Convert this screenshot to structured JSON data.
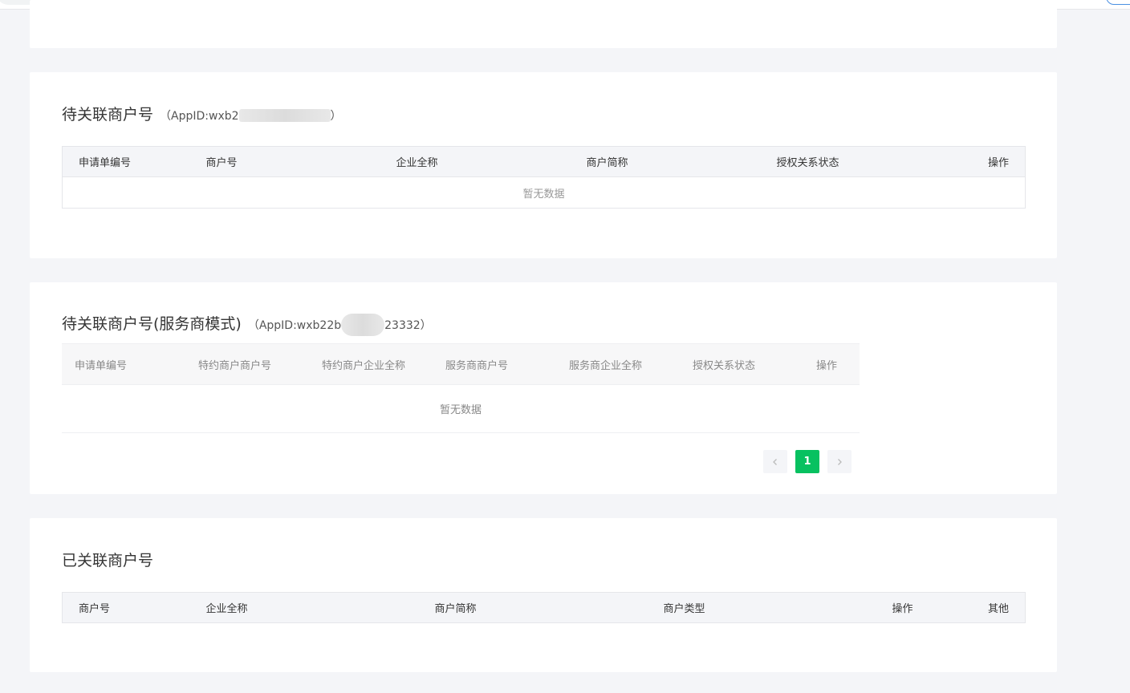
{
  "section_pending": {
    "title": "待关联商户号",
    "appid_prefix": "（AppID:wxb2",
    "appid_suffix": "）",
    "columns": [
      "申请单编号",
      "商户号",
      "企业全称",
      "商户简称",
      "授权关系状态",
      "操作"
    ],
    "empty_text": "暂无数据"
  },
  "section_provider": {
    "title": "待关联商户号(服务商模式)",
    "appid_prefix": "（AppID:wxb22b",
    "appid_suffix": "23332）",
    "columns": [
      "申请单编号",
      "特约商户商户号",
      "特约商户企业全称",
      "服务商商户号",
      "服务商企业全称",
      "授权关系状态",
      "操作"
    ],
    "empty_text": "暂无数据",
    "pagination": {
      "current_page": "1",
      "prev_icon": "chevron-left-icon",
      "next_icon": "chevron-right-icon"
    }
  },
  "section_linked": {
    "title": "已关联商户号",
    "columns": [
      "商户号",
      "企业全称",
      "商户简称",
      "商户类型",
      "操作",
      "其他"
    ]
  },
  "colors": {
    "accent": "#07c160",
    "page_bg": "#f4f5f8",
    "header_bg": "#f4f5f8"
  }
}
